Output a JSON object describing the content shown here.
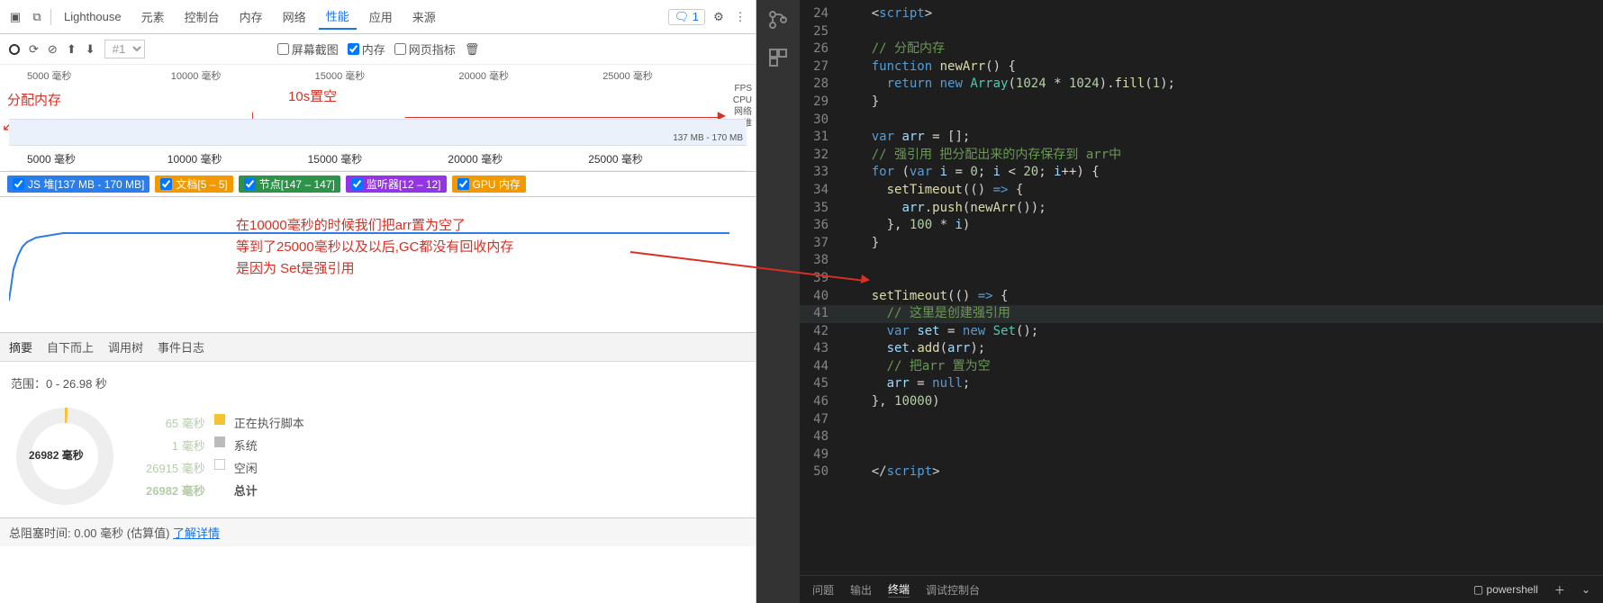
{
  "devtools": {
    "tabs": [
      "Lighthouse",
      "元素",
      "控制台",
      "内存",
      "网络",
      "性能",
      "应用",
      "来源"
    ],
    "active_tab": "性能",
    "issues_badge": "1",
    "controls": {
      "filter_placeholder": "#1",
      "screenshot": "屏幕截图",
      "memory": "内存",
      "web_vitals": "网页指标"
    },
    "timeline": {
      "ticks1": [
        "5000 毫秒",
        "10000 毫秒",
        "15000 毫秒",
        "20000 毫秒",
        "25000 毫秒"
      ],
      "side": [
        "FPS",
        "CPU",
        "网络",
        "堆"
      ],
      "mem_label": "137 MB - 170 MB",
      "ticks2": [
        "5000 毫秒",
        "10000 毫秒",
        "15000 毫秒",
        "20000 毫秒",
        "25000 毫秒"
      ]
    },
    "annotations": {
      "alloc": "分配内存",
      "clear10s": "10s置空",
      "main_lines": [
        "在10000毫秒的时候我们把arr置为空了",
        "等到了25000毫秒以及以后,GC都没有回收内存",
        "是因为          Set是强引用"
      ]
    },
    "memory_checks": {
      "js_heap": "JS 堆[137 MB - 170 MB]",
      "docs": "文档[5 – 5]",
      "nodes": "节点[147 – 147]",
      "listeners": "监听器[12 – 12]",
      "gpu": "GPU 内存"
    },
    "lower_tabs": [
      "摘要",
      "自下而上",
      "调用树",
      "事件日志"
    ],
    "summary": {
      "range": "范围：0 - 26.98 秒",
      "donut_center": "26982 毫秒",
      "rows": [
        {
          "v": "65 毫秒",
          "lbl": "正在执行脚本",
          "sw": "sw-y"
        },
        {
          "v": "1 毫秒",
          "lbl": "系统",
          "sw": "sw-g"
        },
        {
          "v": "26915 毫秒",
          "lbl": "空闲",
          "sw": "sw-w"
        },
        {
          "v": "26982 毫秒",
          "lbl": "总计",
          "sw": ""
        }
      ],
      "footer_prefix": "总阻塞时间: 0.00 毫秒 (估算值) ",
      "footer_link": "了解详情"
    }
  },
  "vscode": {
    "code_lines": [
      {
        "n": 24,
        "html": "<span class='op'>&lt;</span><span class='kw'>script</span><span class='op'>&gt;</span>"
      },
      {
        "n": 25,
        "html": ""
      },
      {
        "n": 26,
        "html": "<span class='cm'>// 分配内存</span>"
      },
      {
        "n": 27,
        "html": "<span class='kw'>function</span> <span class='fn'>newArr</span>() {"
      },
      {
        "n": 28,
        "html": "  <span class='kw'>return</span> <span class='kw'>new</span> <span class='ty'>Array</span>(<span class='num'>1024</span> * <span class='num'>1024</span>).<span class='fn'>fill</span>(<span class='num'>1</span>);"
      },
      {
        "n": 29,
        "html": "}"
      },
      {
        "n": 30,
        "html": ""
      },
      {
        "n": 31,
        "html": "<span class='kw'>var</span> <span class='id'>arr</span> = [];"
      },
      {
        "n": 32,
        "html": "<span class='cm'>// 强引用 把分配出来的内存保存到 arr中</span>"
      },
      {
        "n": 33,
        "html": "<span class='kw'>for</span> (<span class='kw'>var</span> <span class='id'>i</span> = <span class='num'>0</span>; <span class='id'>i</span> &lt; <span class='num'>20</span>; <span class='id'>i</span>++) {"
      },
      {
        "n": 34,
        "html": "  <span class='fn'>setTimeout</span>(() <span class='kw'>=&gt;</span> {"
      },
      {
        "n": 35,
        "html": "    <span class='id'>arr</span>.<span class='fn'>push</span>(<span class='fn'>newArr</span>());"
      },
      {
        "n": 36,
        "html": "  }, <span class='num'>100</span> * <span class='id'>i</span>)"
      },
      {
        "n": 37,
        "html": "}"
      },
      {
        "n": 38,
        "html": ""
      },
      {
        "n": 39,
        "html": ""
      },
      {
        "n": 40,
        "html": "<span class='fn'>setTimeout</span>(() <span class='kw'>=&gt;</span> {"
      },
      {
        "n": 41,
        "html": "  <span class='cm'>// 这里是创建强引用</span>",
        "hl": true
      },
      {
        "n": 42,
        "html": "  <span class='kw'>var</span> <span class='id'>set</span> = <span class='kw'>new</span> <span class='ty'>Set</span>();"
      },
      {
        "n": 43,
        "html": "  <span class='id'>set</span>.<span class='fn'>add</span>(<span class='id'>arr</span>);"
      },
      {
        "n": 44,
        "html": "  <span class='cm'>// 把arr 置为空</span>"
      },
      {
        "n": 45,
        "html": "  <span class='id'>arr</span> = <span class='kw'>null</span>;"
      },
      {
        "n": 46,
        "html": "}, <span class='num'>10000</span>)"
      },
      {
        "n": 47,
        "html": ""
      },
      {
        "n": 48,
        "html": ""
      },
      {
        "n": 49,
        "html": ""
      },
      {
        "n": 50,
        "html": "<span class='op'>&lt;/</span><span class='kw'>script</span><span class='op'>&gt;</span>"
      }
    ],
    "bottom_tabs": [
      "问题",
      "输出",
      "终端",
      "调试控制台"
    ],
    "active_bottom": "终端",
    "terminal_label": "powershell"
  }
}
